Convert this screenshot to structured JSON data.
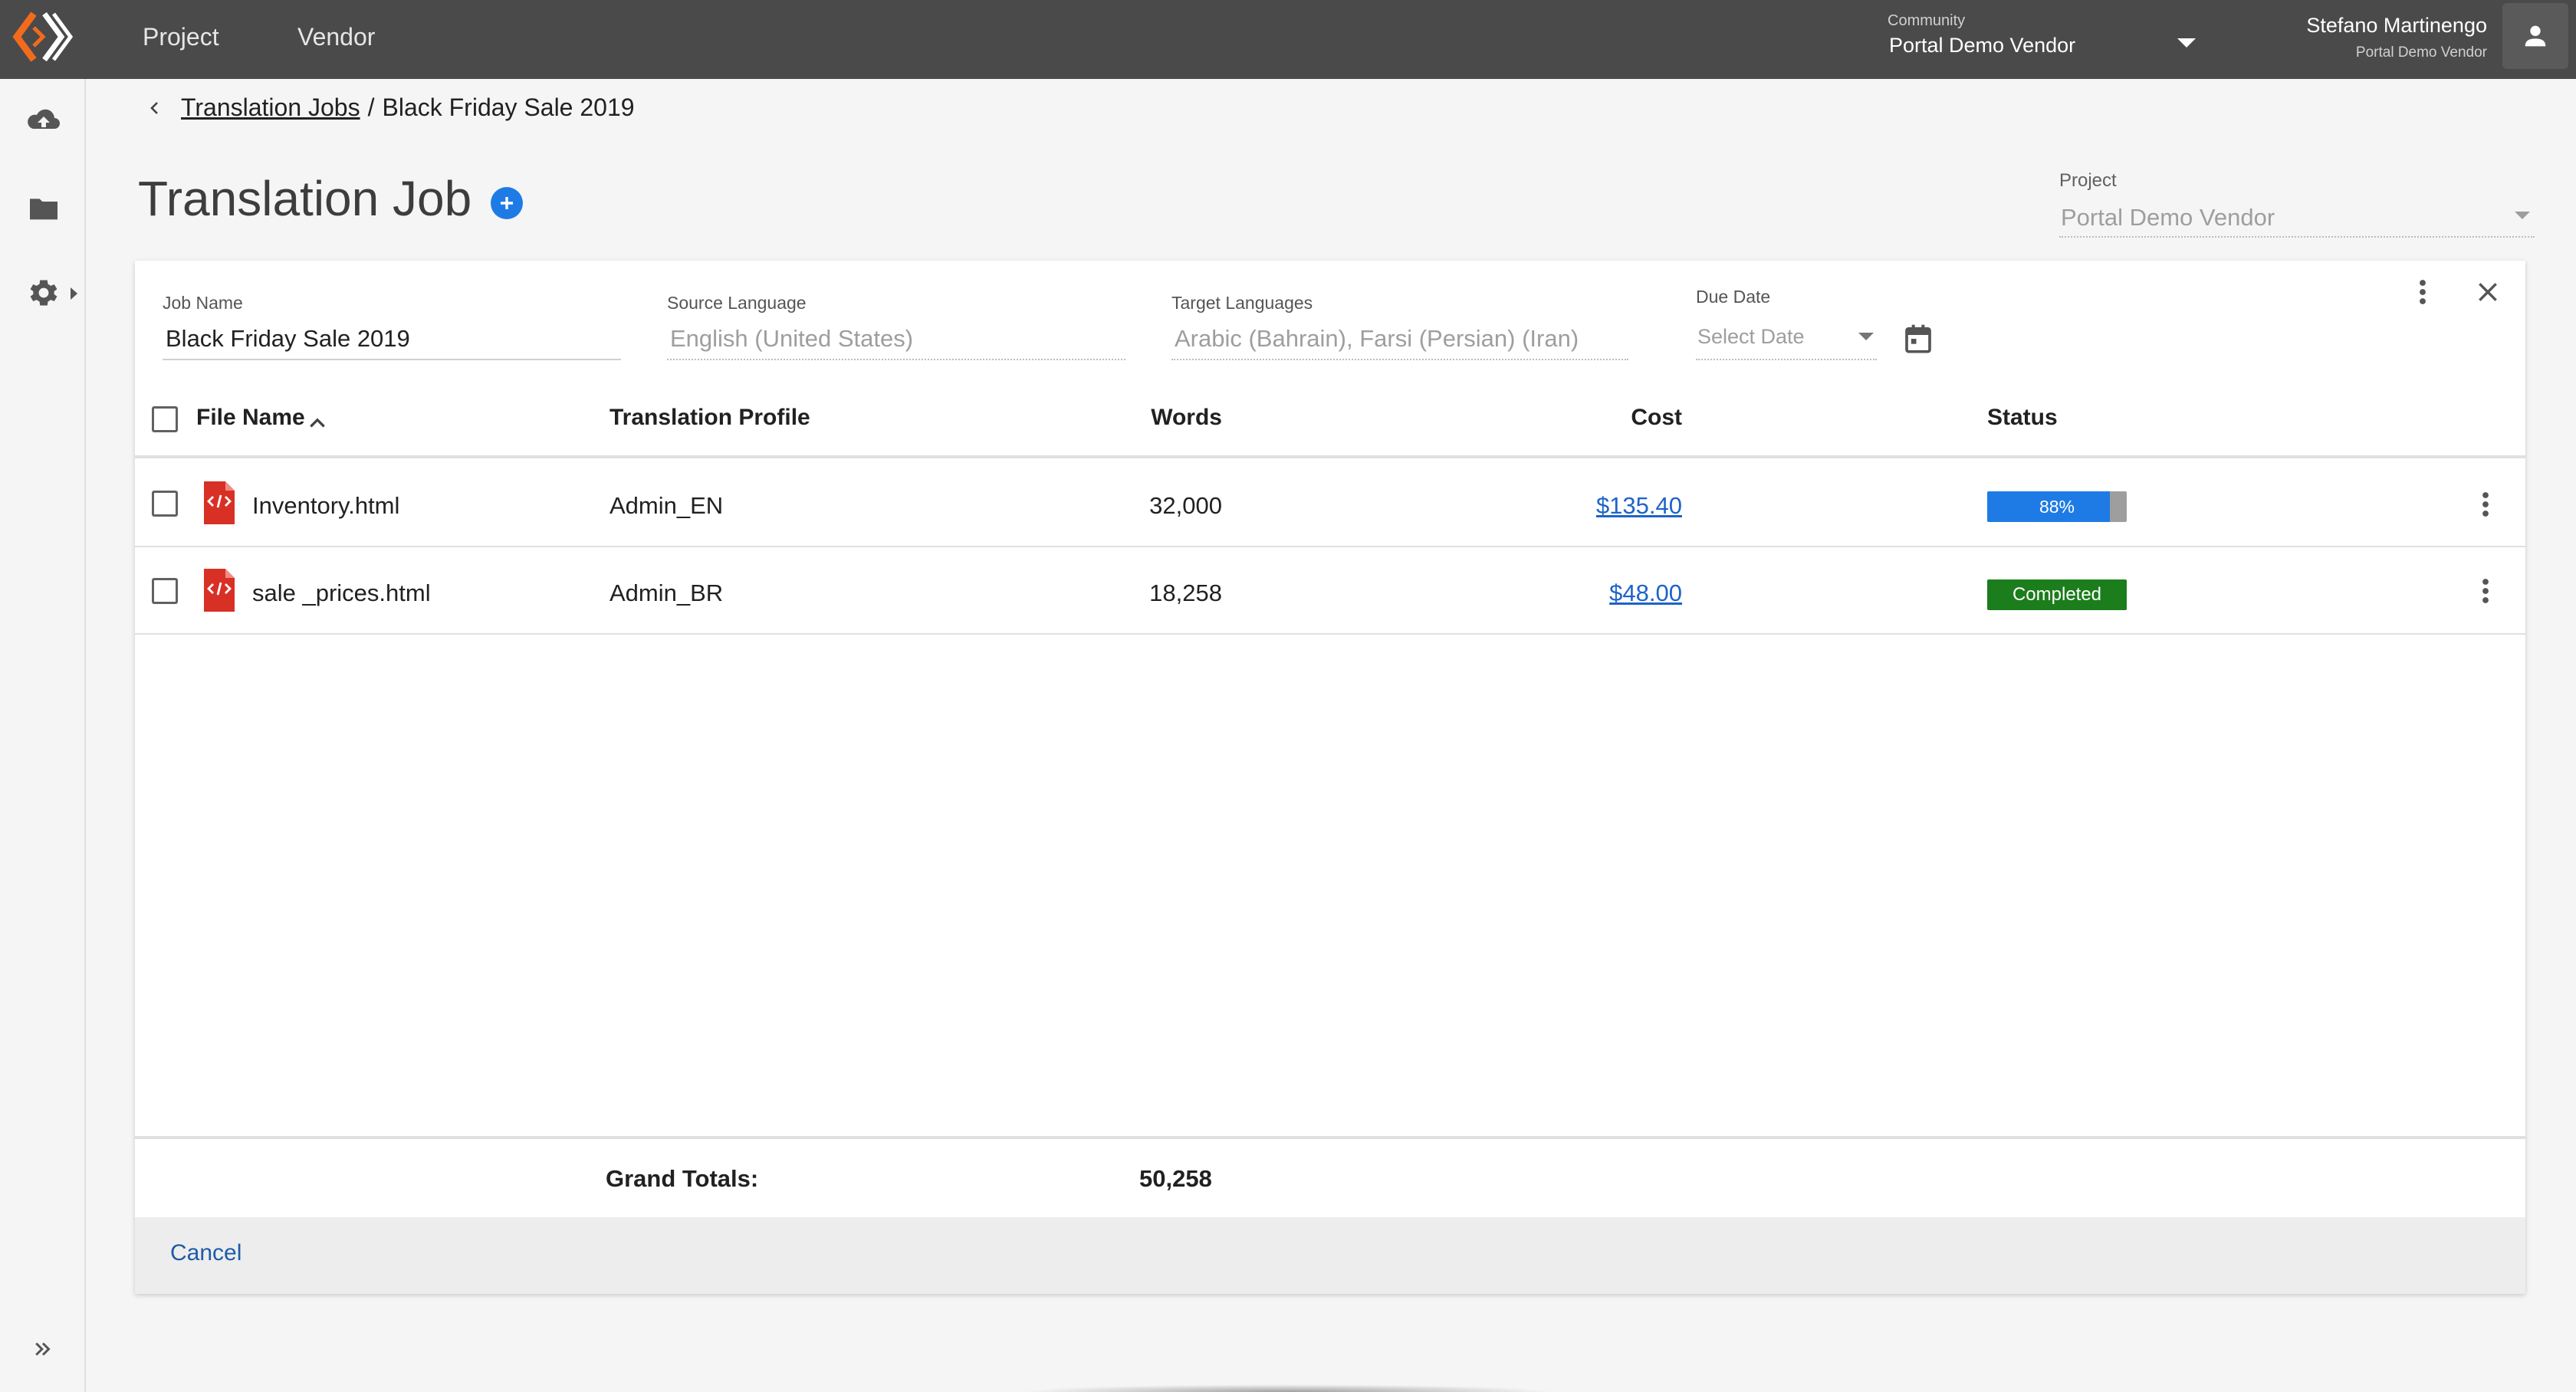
{
  "topbar": {
    "nav": [
      "Project",
      "Vendor"
    ],
    "community_label": "Community",
    "community_value": "Portal Demo Vendor",
    "user_name": "Stefano Martinengo",
    "user_org": "Portal Demo Vendor"
  },
  "sidebar": {
    "icons": [
      "cloud-upload-icon",
      "folder-icon",
      "gear-icon"
    ],
    "expand_icon": "double-chevron-right-icon"
  },
  "breadcrumb": {
    "parent": "Translation Jobs",
    "separator": "/",
    "current": "Black Friday Sale 2019"
  },
  "page": {
    "title": "Translation Job",
    "project_label": "Project",
    "project_value": "Portal Demo Vendor"
  },
  "job": {
    "name_label": "Job Name",
    "name_value": "Black Friday Sale 2019",
    "source_label": "Source Language",
    "source_value": "English (United States)",
    "target_label": "Target Languages",
    "target_value": "Arabic (Bahrain), Farsi (Persian) (Iran)",
    "due_label": "Due Date",
    "due_placeholder": "Select Date"
  },
  "table": {
    "headers": {
      "file_name": "File Name",
      "profile": "Translation Profile",
      "words": "Words",
      "cost": "Cost",
      "status": "Status"
    },
    "rows": [
      {
        "file": "Inventory.html",
        "file_icon_label": "HTML",
        "profile": "Admin_EN",
        "words": "32,000",
        "cost": "$135.40",
        "status_type": "progress",
        "progress": 0.88,
        "status_text": "88%"
      },
      {
        "file": "sale _prices.html",
        "file_icon_label": "HTML",
        "profile": "Admin_BR",
        "words": "18,258",
        "cost": "$48.00",
        "status_type": "badge",
        "status_text": "Completed"
      }
    ],
    "totals_label": "Grand Totals:",
    "totals_words": "50,258"
  },
  "footer": {
    "cancel_label": "Cancel"
  },
  "colors": {
    "topbar": "#4a4a4a",
    "accent_blue": "#1e7be6",
    "link_blue": "#1e63c7",
    "success_green": "#1b7d1b",
    "file_icon_red": "#d93025",
    "logo_orange": "#f26b1d"
  }
}
